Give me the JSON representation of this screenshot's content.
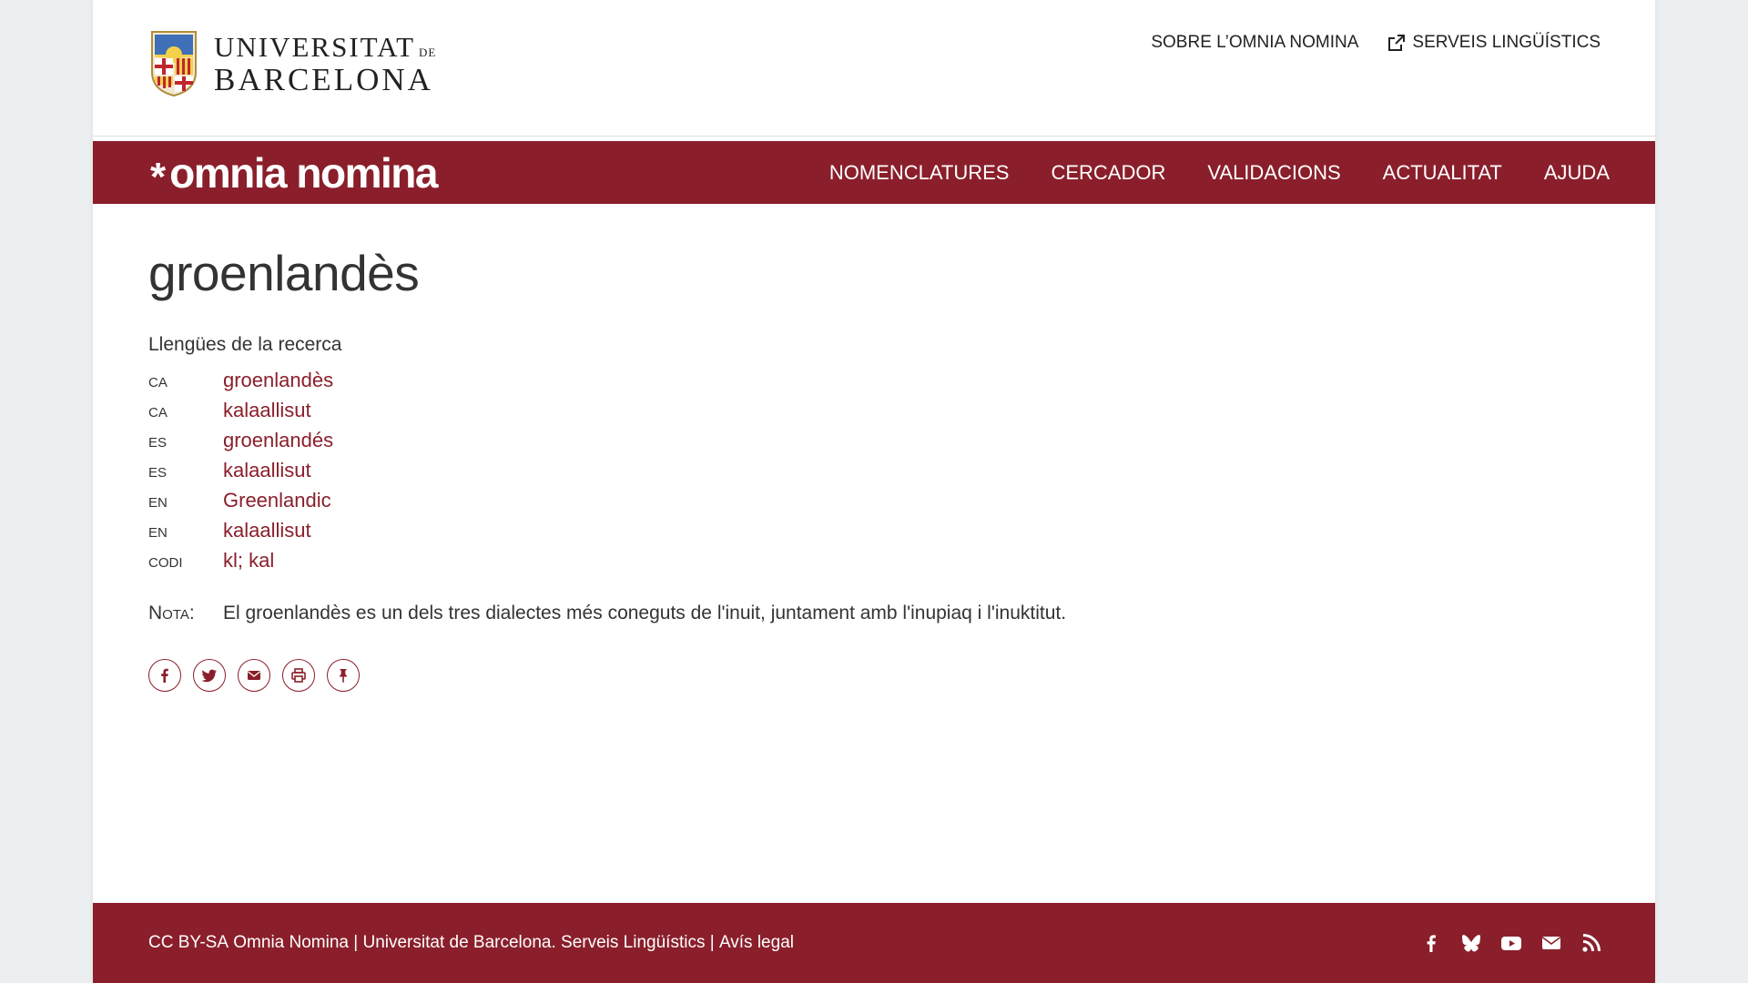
{
  "header": {
    "logo_line1": "UNIVERSITAT",
    "logo_de": "DE",
    "logo_line2": "BARCELONA",
    "top_links": [
      {
        "label": "SOBRE L’OMNIA NOMINA"
      },
      {
        "label": "SERVEIS LINGÜÍSTICS",
        "icon": "external-link-icon"
      }
    ]
  },
  "navbar": {
    "brand_star": "*",
    "brand_text": "omnia nomina",
    "items": [
      {
        "label": "NOMENCLATURES"
      },
      {
        "label": "CERCADOR"
      },
      {
        "label": "VALIDACIONS"
      },
      {
        "label": "ACTUALITAT"
      },
      {
        "label": "AJUDA"
      }
    ]
  },
  "main": {
    "title": "groenlandès",
    "section_label": "Llengües de la recerca",
    "languages": [
      {
        "code": "CA",
        "term": "groenlandès"
      },
      {
        "code": "CA",
        "term": "kalaallisut"
      },
      {
        "code": "ES",
        "term": "groenlandés"
      },
      {
        "code": "ES",
        "term": "kalaallisut"
      },
      {
        "code": "EN",
        "term": "Greenlandic"
      },
      {
        "code": "EN",
        "term": "kalaallisut"
      },
      {
        "code": "CODI",
        "term": "kl; kal"
      }
    ],
    "note_label": "Nota:",
    "note_text": "El groenlandès es un dels tres dialectes més coneguts de l'inuit, juntament amb l'inupiaq i l'inuktitut.",
    "share_icons": [
      "facebook-icon",
      "twitter-icon",
      "email-icon",
      "print-icon",
      "pin-icon"
    ]
  },
  "footer": {
    "license": "CC BY-SA",
    "org": "Omnia Nomina | Universitat de Barcelona. Serveis Lingüístics",
    "separator": " | ",
    "legal": "Avís legal",
    "icons": [
      "facebook-icon",
      "bluesky-icon",
      "youtube-icon",
      "email-icon",
      "rss-icon"
    ]
  },
  "colors": {
    "brand": "#8a1f2b",
    "text": "#333333",
    "background": "#eceff1"
  }
}
